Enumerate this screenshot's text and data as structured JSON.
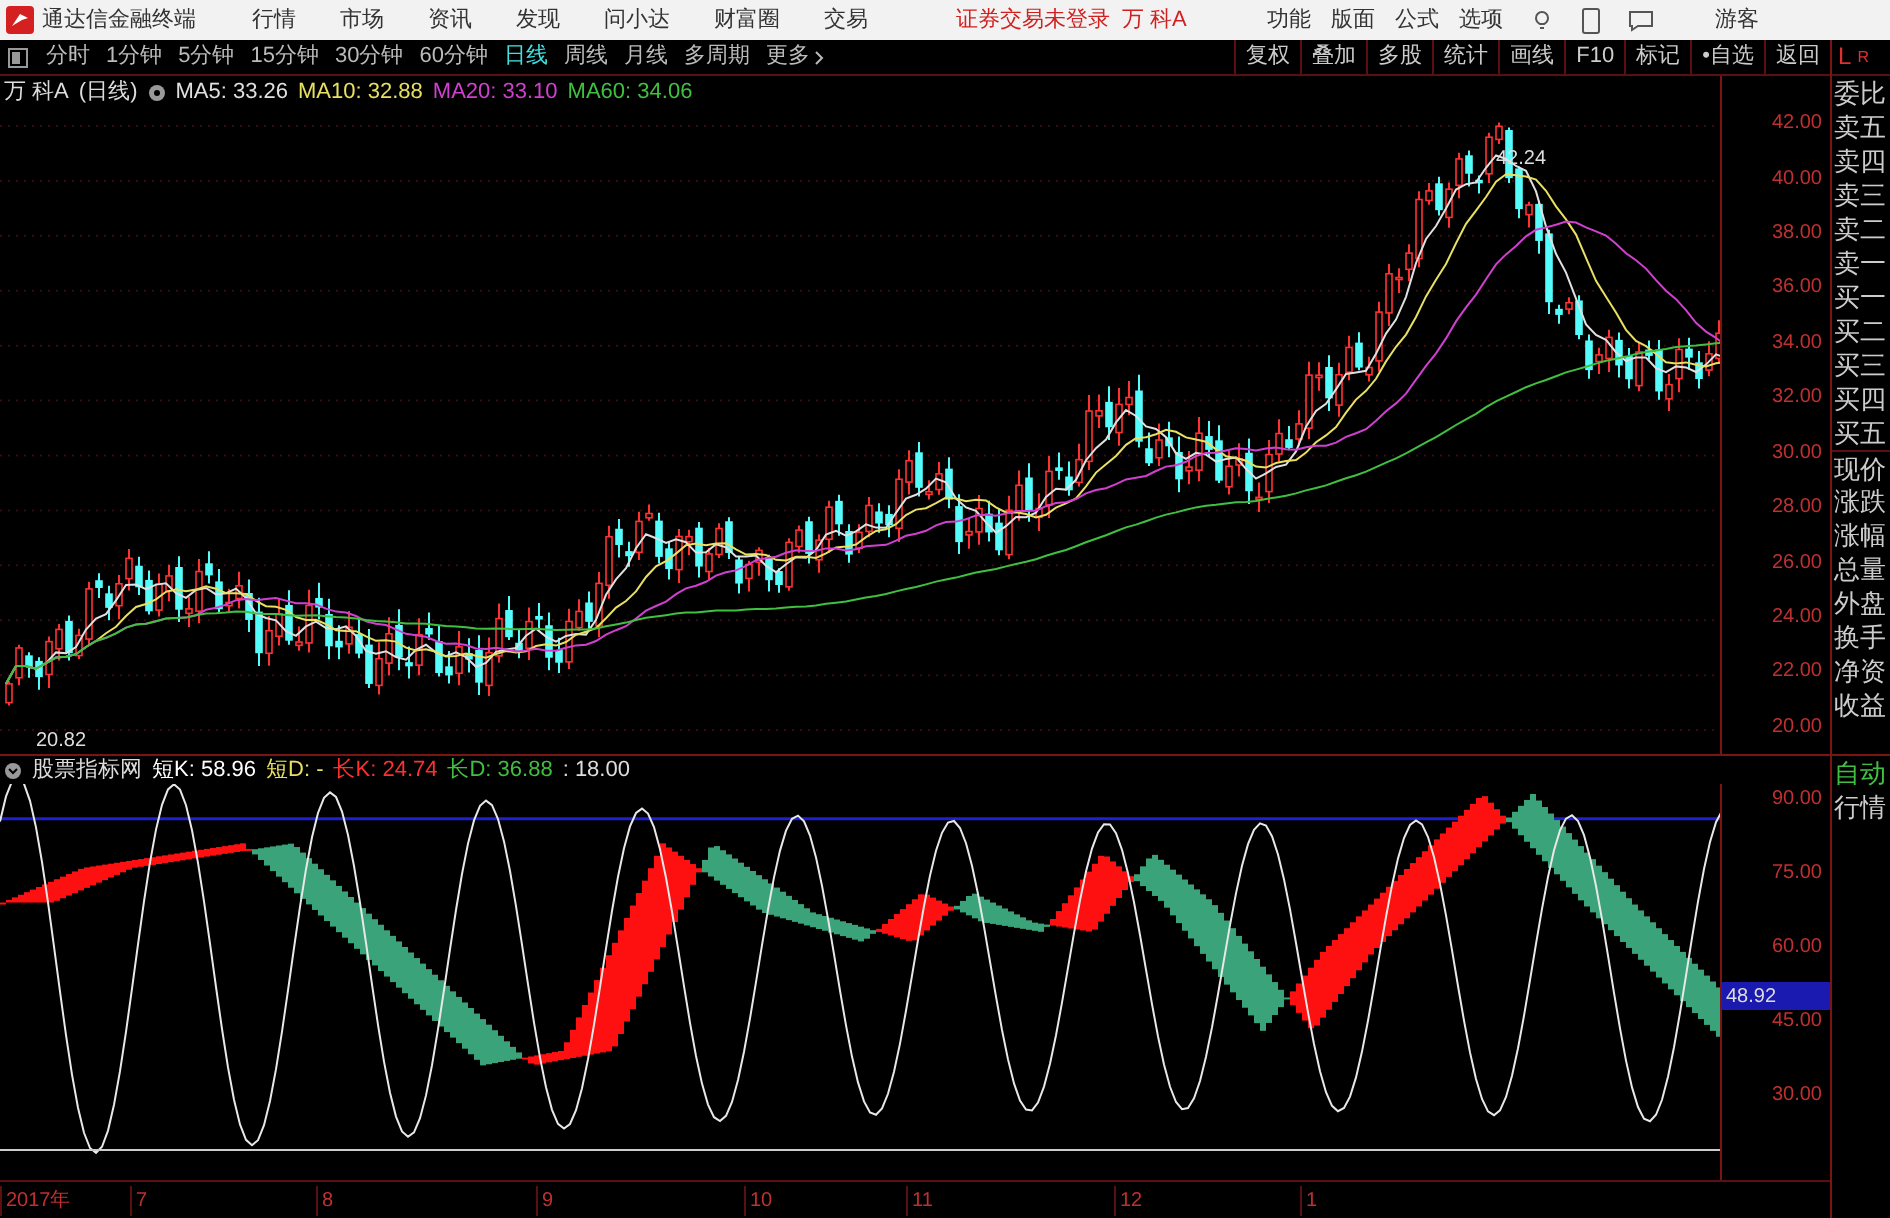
{
  "menu_bar": {
    "app_title": "通达信金融终端",
    "menus": [
      "行情",
      "市场",
      "资讯",
      "发现",
      "问小达",
      "财富圈",
      "交易"
    ],
    "login_status": "证券交易未登录",
    "stock": "万 科A",
    "actions": [
      "功能",
      "版面",
      "公式",
      "选项"
    ],
    "user": "游客"
  },
  "period_bar": {
    "periods": [
      {
        "label": "分时",
        "selected": false
      },
      {
        "label": "1分钟",
        "selected": false
      },
      {
        "label": "5分钟",
        "selected": false
      },
      {
        "label": "15分钟",
        "selected": false
      },
      {
        "label": "30分钟",
        "selected": false
      },
      {
        "label": "60分钟",
        "selected": false
      },
      {
        "label": "日线",
        "selected": true
      },
      {
        "label": "周线",
        "selected": false
      },
      {
        "label": "月线",
        "selected": false
      },
      {
        "label": "多周期",
        "selected": false
      }
    ],
    "more": "更多",
    "tools": [
      "复权",
      "叠加",
      "多股",
      "统计",
      "画线",
      "F10",
      "标记",
      "•自选",
      "返回"
    ]
  },
  "main_chart": {
    "stock_label": "万 科A",
    "period_label": "(日线)",
    "ma": [
      {
        "label": "MA5:",
        "value": "33.26",
        "color": "#e0e0e0"
      },
      {
        "label": "MA10:",
        "value": "32.88",
        "color": "#e8e060"
      },
      {
        "label": "MA20:",
        "value": "33.10",
        "color": "#d040d0"
      },
      {
        "label": "MA60:",
        "value": "34.06",
        "color": "#40c040"
      }
    ],
    "high_label": "42.24",
    "low_label": "20.82",
    "price_ticks": [
      "42.00",
      "40.00",
      "38.00",
      "36.00",
      "34.00",
      "32.00",
      "30.00",
      "28.00",
      "26.00",
      "24.00",
      "22.00",
      "20.00"
    ]
  },
  "indicator": {
    "name": "股票指标网",
    "values": [
      {
        "label": "短K:",
        "value": "58.96",
        "color": "#ffffff"
      },
      {
        "label": "短D:",
        "value": "-",
        "color": "#e8e060"
      },
      {
        "label": "长K:",
        "value": "24.74",
        "color": "#ff3030"
      },
      {
        "label": "长D:",
        "value": "36.88",
        "color": "#40c040"
      }
    ],
    "extra": ": 18.00",
    "ticks": [
      "90.00",
      "75.00",
      "60.00",
      "45.00",
      "30.00"
    ],
    "current": "48.92"
  },
  "side_panel": {
    "header": [
      "L",
      "R"
    ],
    "quote_fields": [
      "委比",
      "卖五",
      "卖四",
      "卖三",
      "卖二",
      "卖一",
      "买一",
      "买二",
      "买三",
      "买四",
      "买五",
      "现价",
      "涨跌",
      "涨幅",
      "总量",
      "外盘",
      "换手",
      "净资",
      "收益"
    ],
    "auto_fields": [
      "自动",
      "行情"
    ]
  },
  "time_axis": [
    "2017年",
    "7",
    "8",
    "9",
    "10",
    "11",
    "12",
    "1"
  ]
}
